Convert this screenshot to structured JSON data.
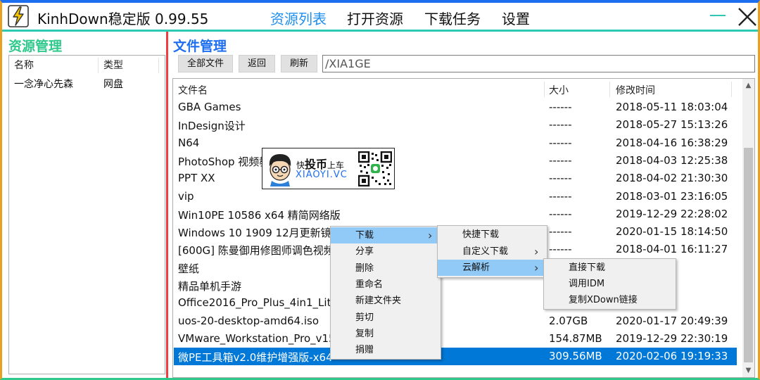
{
  "app": {
    "title": "KinhDown稳定版 0.99.55"
  },
  "nav": [
    "资源列表",
    "打开资源",
    "下载任务",
    "设置"
  ],
  "left": {
    "title": "资源管理",
    "headers": [
      "名称",
      "类型"
    ],
    "rows": [
      {
        "name": "一念净心先森",
        "type": "网盘"
      }
    ]
  },
  "right": {
    "title": "文件管理",
    "buttons": [
      "全部文件",
      "返回",
      "刷新"
    ],
    "path": "/XIA1GE",
    "headers": [
      "文件名",
      "大小",
      "修改时间"
    ],
    "files": [
      {
        "name": "GBA Games",
        "size": "------",
        "time": "2018-05-11 18:03:04"
      },
      {
        "name": "InDesign设计",
        "size": "------",
        "time": "2018-05-27 15:13:26"
      },
      {
        "name": "N64",
        "size": "------",
        "time": "2018-04-16 16:38:29"
      },
      {
        "name": "PhotoShop 视频教程",
        "size": "------",
        "time": "2018-04-03 12:25:38"
      },
      {
        "name": "PPT XX",
        "size": "------",
        "time": "2018-04-02 21:30:30"
      },
      {
        "name": "vip",
        "size": "------",
        "time": "2018-03-01 23:16:05"
      },
      {
        "name": "Win10PE 10586 x64 精简网络版",
        "size": "------",
        "time": "2019-12-29 22:28:02"
      },
      {
        "name": "Windows 10 1909 12月更新镜像",
        "size": "------",
        "time": "2020-01-15 18:14:50"
      },
      {
        "name": "[600G] 陈曼御用修图师调色视频教程",
        "size": "------",
        "time": "2018-04-01 16:11:27"
      },
      {
        "name": "壁纸",
        "size": "",
        "time": "02:17:19"
      },
      {
        "name": "精品单机手游",
        "size": "",
        "time": "13:49:35"
      },
      {
        "name": "Office2016_Pro_Plus_4in1_Lite_",
        "size": "",
        "time": "21:42:00"
      },
      {
        "name": "uos-20-desktop-amd64.iso",
        "size": "2.07GB",
        "time": "2020-01-17 20:49:39"
      },
      {
        "name": "VMware_Workstation_Pro_v15.",
        "size": "154.87MB",
        "time": "2019-12-29 22:30:19"
      },
      {
        "name": "微PE工具箱v2.0维护增强版-x64-",
        "size": "309.56MB",
        "time": "2020-02-06 19:19:33"
      }
    ],
    "selected_index": 14
  },
  "watermark": {
    "line1_pre": "快",
    "line1_bold": "投币",
    "line1_post": "上车",
    "line2": "XIAOYI.VC"
  },
  "context_menu": {
    "main": [
      "下载",
      "分享",
      "删除",
      "重命名",
      "新建文件夹",
      "剪切",
      "复制",
      "捐赠"
    ],
    "download_sub": [
      "快捷下载",
      "自定义下载",
      "云解析"
    ],
    "cloud_sub": [
      "直接下载",
      "调用IDM",
      "复制XDown链接"
    ]
  },
  "colors": {
    "accent": "#1e8ef0",
    "left_title": "#2ec98b",
    "right_title": "#1e6ef0",
    "divider": "#ef3e3e",
    "selection": "#0078d7",
    "menu_highlight": "#91c9f7"
  },
  "icons": [
    "lightning-icon",
    "minimize-icon",
    "close-icon",
    "submenu-arrow-icon",
    "scroll-up-icon",
    "scroll-down-icon",
    "qr-code-icon",
    "avatar-cartoon-icon"
  ]
}
